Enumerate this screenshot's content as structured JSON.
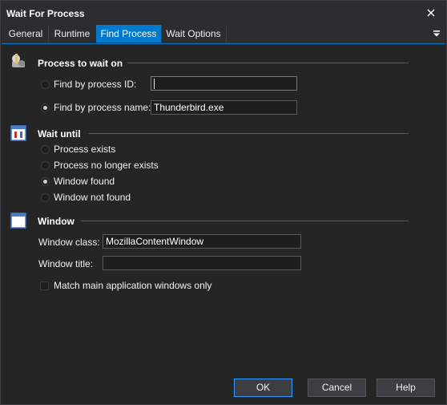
{
  "window": {
    "title": "Wait For Process"
  },
  "tabs": [
    {
      "label": "General"
    },
    {
      "label": "Runtime"
    },
    {
      "label": "Find Process"
    },
    {
      "label": "Wait Options"
    }
  ],
  "active_tab": "Find Process",
  "sections": {
    "process": {
      "title": "Process to wait on",
      "by_id_label": "Find by process ID:",
      "by_id_value": "",
      "by_id_checked": false,
      "by_name_label": "Find by process name:",
      "by_name_value": "Thunderbird.exe",
      "by_name_checked": true
    },
    "wait_until": {
      "title": "Wait until",
      "options": [
        {
          "label": "Process exists",
          "checked": false
        },
        {
          "label": "Process no longer exists",
          "checked": false
        },
        {
          "label": "Window found",
          "checked": true
        },
        {
          "label": "Window not found",
          "checked": false
        }
      ]
    },
    "window": {
      "title": "Window",
      "class_label": "Window class:",
      "class_value": "MozillaContentWindow",
      "title_label": "Window title:",
      "title_value": "",
      "match_main_label": "Match main application windows only",
      "match_main_checked": false
    }
  },
  "buttons": {
    "ok": "OK",
    "cancel": "Cancel",
    "help": "Help"
  },
  "colors": {
    "accent": "#007acc",
    "background": "#252526",
    "text": "#f1f1f1"
  },
  "icons": [
    "close-icon",
    "tab-menu-icon",
    "process-icon",
    "wait-icon",
    "window-icon"
  ]
}
